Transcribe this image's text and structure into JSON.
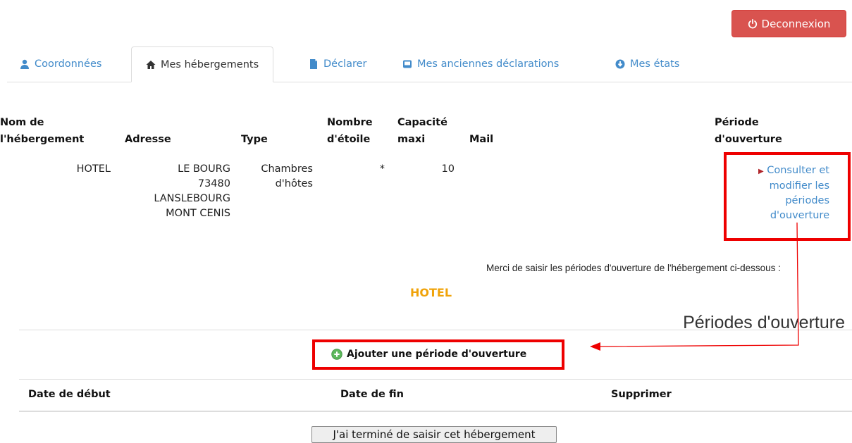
{
  "header": {
    "logout_label": "Deconnexion"
  },
  "tabs": [
    {
      "label": "Coordonnées",
      "icon": "user-icon"
    },
    {
      "label": "Mes hébergements",
      "icon": "home-icon"
    },
    {
      "label": "Déclarer",
      "icon": "file-icon"
    },
    {
      "label": "Mes anciennes déclarations",
      "icon": "inbox-icon"
    },
    {
      "label": "Mes états",
      "icon": "circle-arrow-down-icon"
    }
  ],
  "accommodations": {
    "headers": {
      "name_1": "Nom de",
      "name_2": "l'hébergement",
      "address": "Adresse",
      "type": "Type",
      "stars_1": "Nombre",
      "stars_2": "d'étoile",
      "capacity_1": "Capacité",
      "capacity_2": "maxi",
      "mail": "Mail",
      "period_1": "Période",
      "period_2": "d'ouverture"
    },
    "row": {
      "name": "HOTEL",
      "address_1": "LE BOURG",
      "address_2": "73480",
      "address_3": "LANSLEBOURG",
      "address_4": "MONT CENIS",
      "type_1": "Chambres",
      "type_2": "d'hôtes",
      "stars": "*",
      "capacity": "10",
      "mail": "",
      "link_1": "Consulter et",
      "link_2": "modifier les",
      "link_3": "périodes",
      "link_4": "d'ouverture"
    }
  },
  "periods": {
    "intro": "Merci de saisir les périodes d'ouverture de l'hébergement ci-dessous :",
    "hotel_name": "HOTEL",
    "title": "Périodes d'ouverture",
    "add_label": "Ajouter une période d'ouverture",
    "columns": [
      "Date de début",
      "Date de fin",
      "Supprimer"
    ],
    "finish_label": "J'ai terminé de saisir cet hébergement"
  },
  "colors": {
    "accent": "#428bca",
    "danger": "#d9534f",
    "annotation": "#ee0000",
    "hotel": "#f0a30a"
  }
}
